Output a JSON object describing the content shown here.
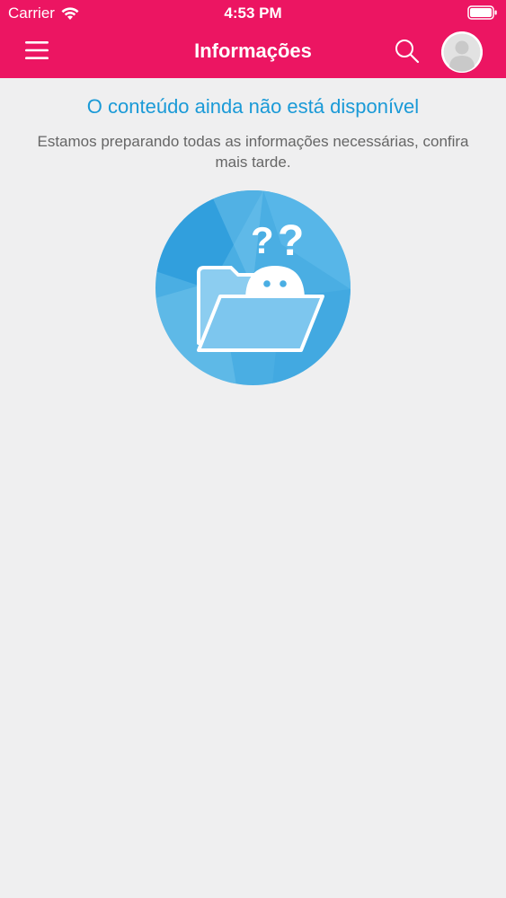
{
  "status_bar": {
    "carrier": "Carrier",
    "time": "4:53 PM",
    "wifi_icon": "wifi-icon",
    "battery_icon": "battery-icon"
  },
  "header": {
    "title": "Informações",
    "menu_icon": "hamburger-menu-icon",
    "search_icon": "search-icon",
    "avatar_icon": "user-avatar-icon",
    "background_color": "#ec1562"
  },
  "empty_state": {
    "title": "O conteúdo ainda não está disponível",
    "description": "Estamos preparando todas as informações necessárias, confira mais tarde.",
    "illustration_icon": "empty-folder-question-icon",
    "title_color": "#1a9ad7"
  }
}
